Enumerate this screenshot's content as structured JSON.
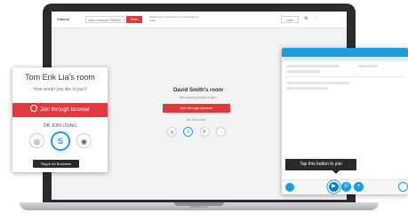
{
  "laptop": {
    "label": "MacBook"
  },
  "topbar": {
    "brand": "Videxio",
    "url_value": "video.example/7088480",
    "join_label": "Enter",
    "note": "Please link to meet with us in a browser or video",
    "lock_label": "Lock"
  },
  "room": {
    "title": "David Smith's room",
    "subtitle": "How would you like to join?",
    "join_button": "Join through browser",
    "or_text": "OR JOIN USING"
  },
  "popup": {
    "title": "Tom Erik Lia's room",
    "subtitle": "How would you like to join?",
    "join_button": "Join through browser",
    "or_text": "OR JOIN USING",
    "tooltip": "Skype for Business"
  },
  "chat": {
    "tooltip": "Tap this button to join"
  },
  "colors": {
    "accent_red": "#e0393e",
    "skype_blue": "#1a9ee0",
    "laptop_body": "#2b2b2e"
  },
  "icons": {
    "join_options": [
      "video-system-icon",
      "skype-icon",
      "phone-icon",
      "more-icon"
    ],
    "popup_options": [
      "video-system-icon",
      "skype-icon",
      "eye-icon"
    ]
  }
}
